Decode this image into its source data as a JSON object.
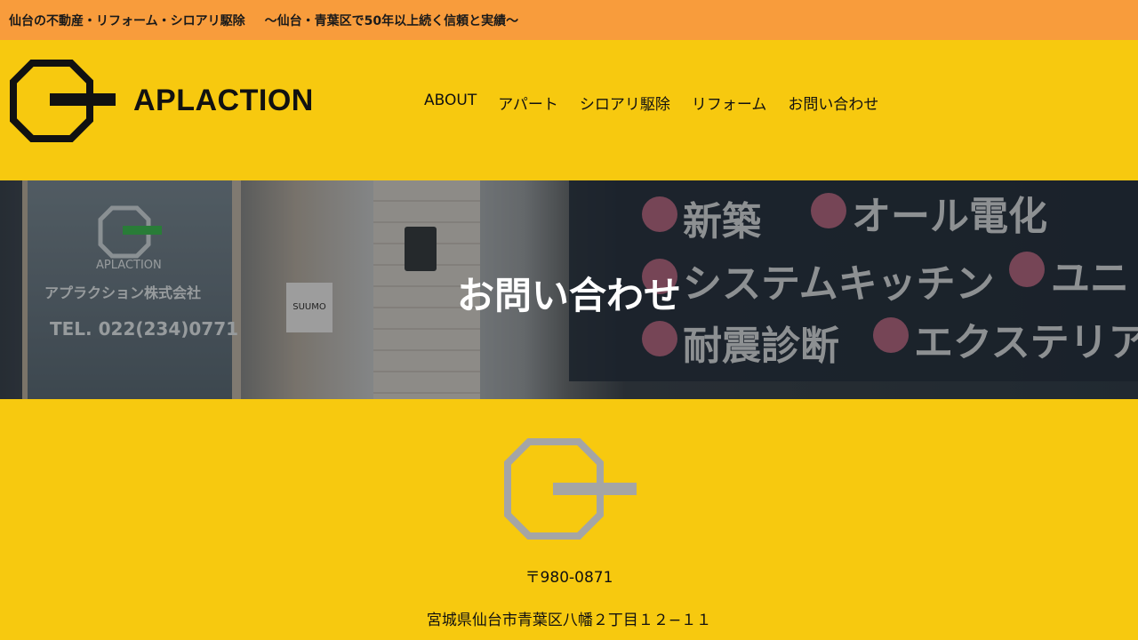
{
  "topbar": {
    "title": "仙台の不動産・リフォーム・シロアリ駆除",
    "tagline": "～仙台・青葉区で50年以上続く信頼と実績～"
  },
  "header": {
    "brand": "APLACTION",
    "nav": [
      "ABOUT",
      "アパート",
      "シロアリ駆除",
      "リフォーム",
      "お問い合わせ"
    ]
  },
  "hero": {
    "title": "お問い合わせ",
    "photo_text": {
      "store_brand": "APLACTION",
      "store_company": "アプラクション株式会社",
      "store_phone": "TEL. 022(234)0771",
      "sign": "SUUMO",
      "row1": [
        "新築",
        "オール電化"
      ],
      "row2": [
        "システムキッチン",
        "ユニ"
      ],
      "row3": [
        "耐震診断",
        "エクステリア"
      ]
    }
  },
  "footer": {
    "postal": "〒980-0871",
    "address": "宮城県仙台市青葉区八幡２丁目１２−１１"
  },
  "colors": {
    "topbar": "#f89c3c",
    "brand_yellow": "#f7c90f",
    "footer_logo": "#a5a5a5"
  }
}
